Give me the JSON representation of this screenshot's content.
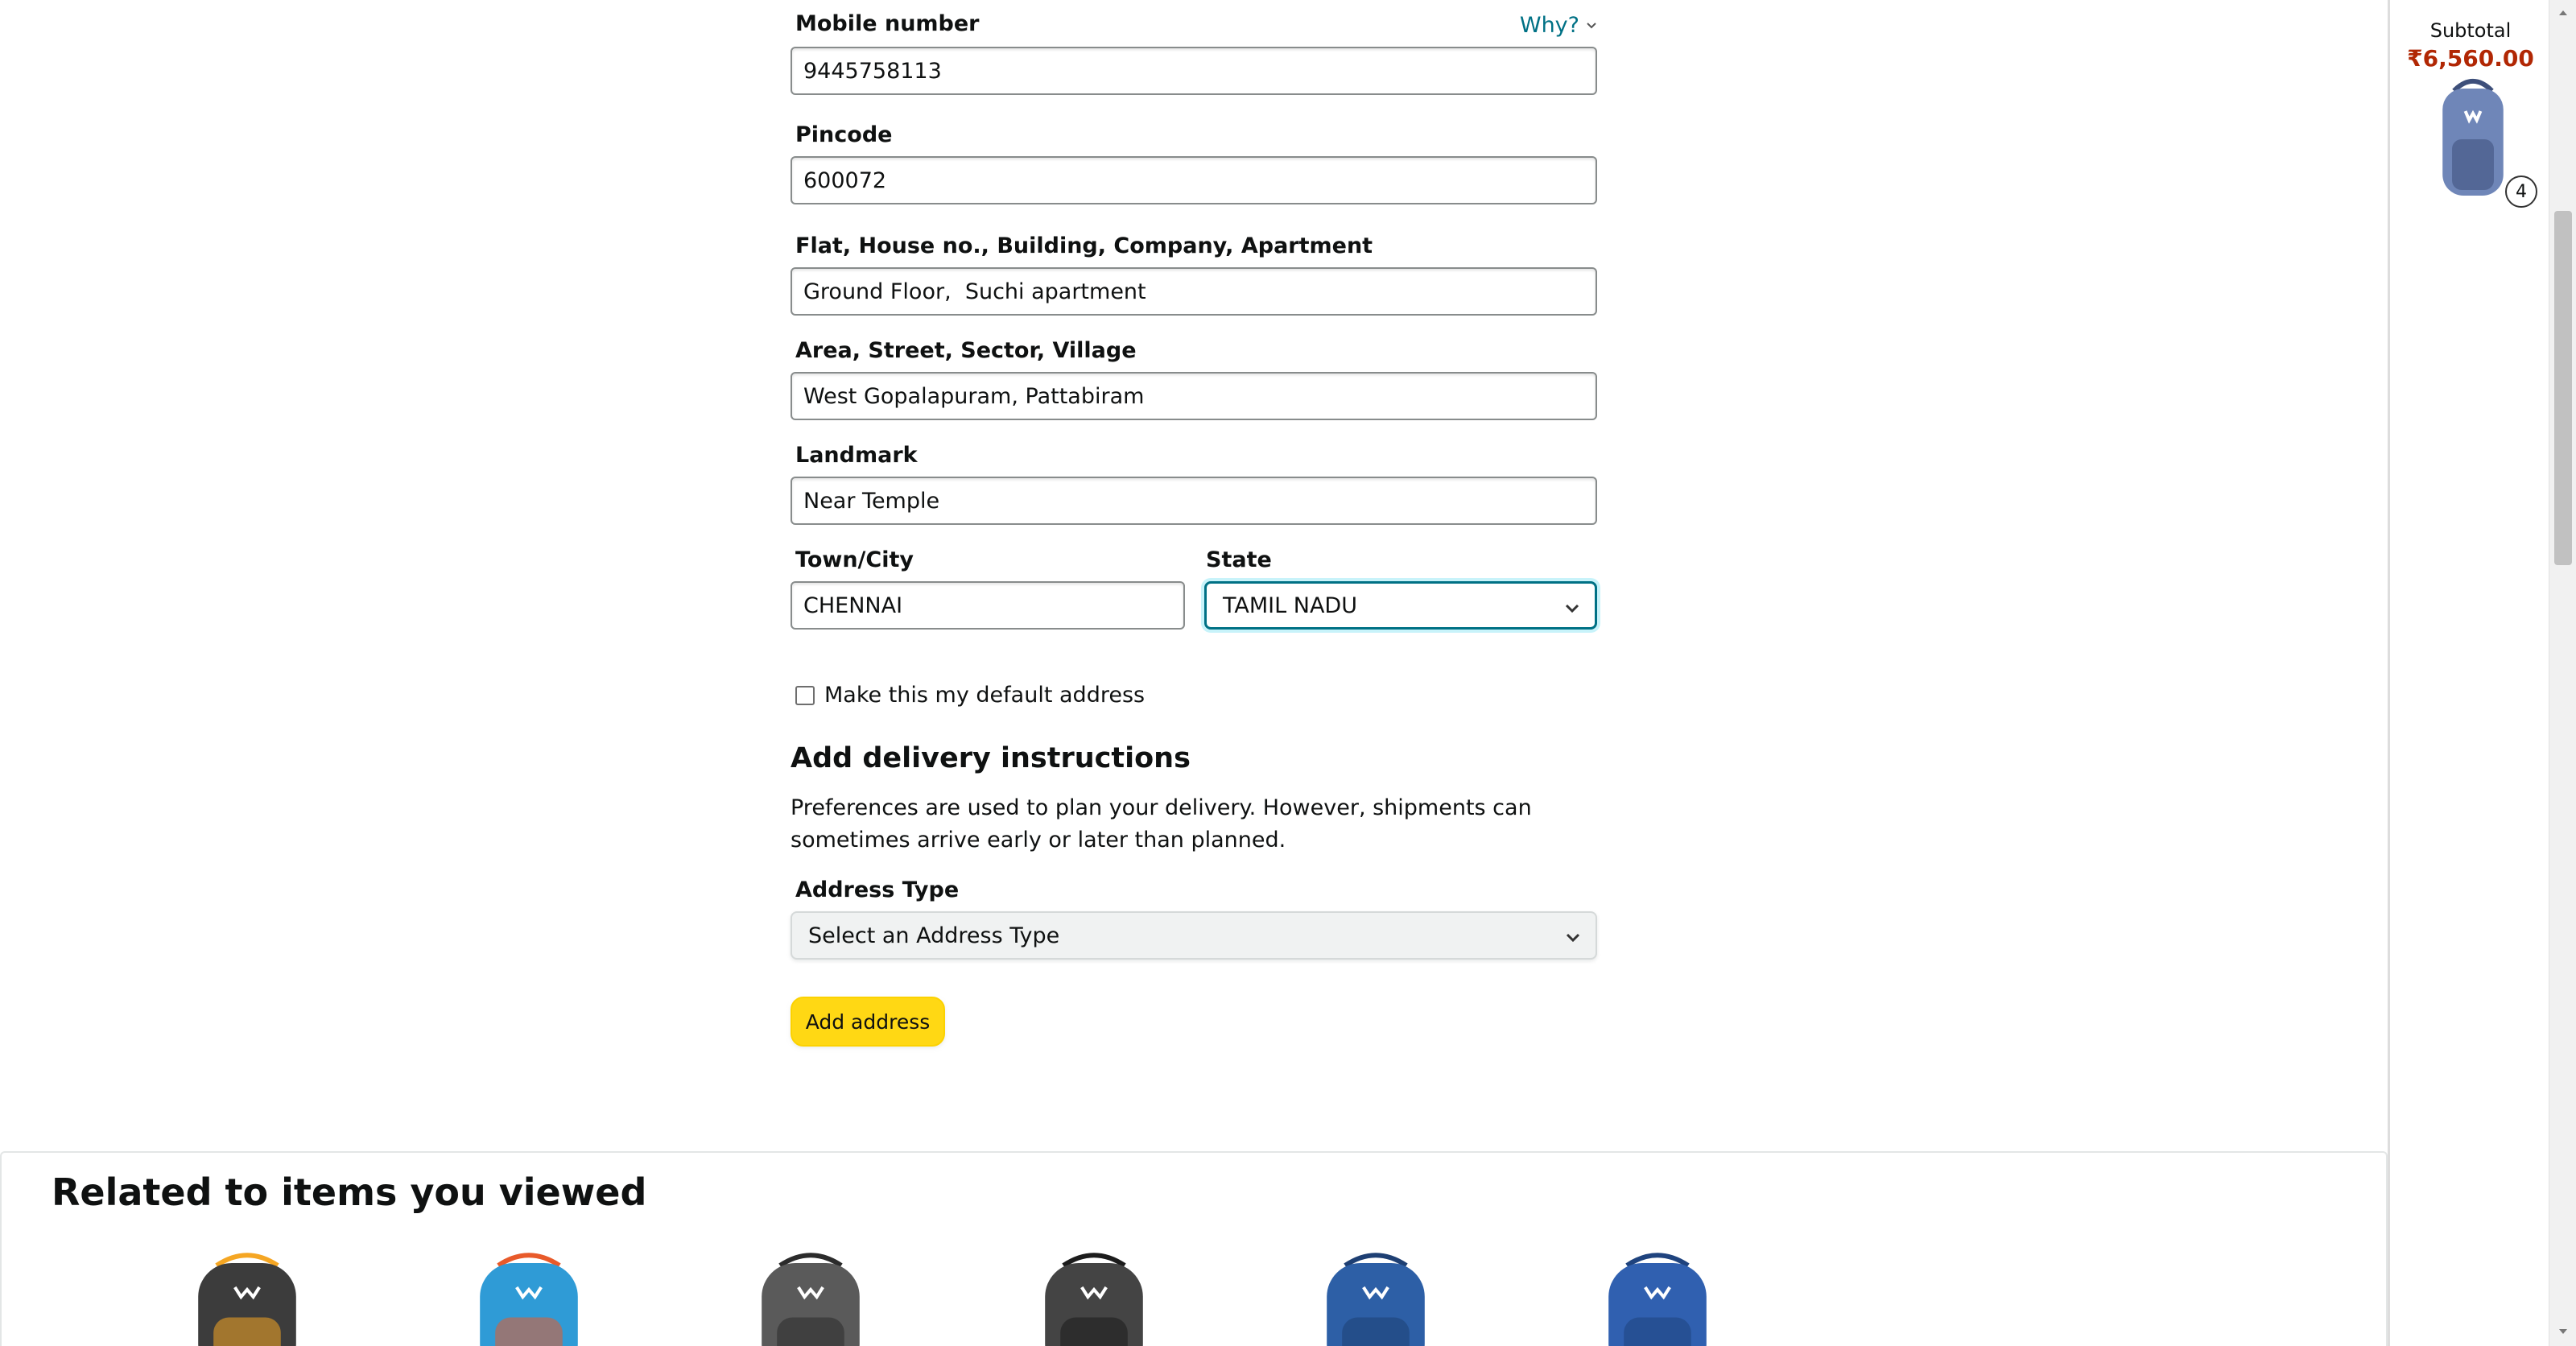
{
  "form": {
    "mobile": {
      "label": "Mobile number",
      "value": "9445758113",
      "why_link": "Why?"
    },
    "pincode": {
      "label": "Pincode",
      "value": "600072"
    },
    "flat": {
      "label": "Flat, House no., Building, Company, Apartment",
      "value": "Ground Floor,  Suchi apartment"
    },
    "area": {
      "label": "Area, Street, Sector, Village",
      "value": "West Gopalapuram, Pattabiram"
    },
    "landmark": {
      "label": "Landmark",
      "value": "Near Temple"
    },
    "city": {
      "label": "Town/City",
      "value": "CHENNAI"
    },
    "state": {
      "label": "State",
      "value": "TAMIL NADU"
    },
    "default_checkbox": {
      "label": "Make this my default address",
      "checked": false
    },
    "instructions": {
      "heading": "Add delivery instructions",
      "description": "Preferences are used to plan your delivery. However, shipments can sometimes arrive early or later than planned."
    },
    "address_type": {
      "label": "Address Type",
      "value": "Select an Address Type"
    },
    "submit_label": "Add address"
  },
  "related": {
    "title": "Related to items you viewed",
    "products": [
      {
        "color": "#3c3c3c",
        "accent": "#f5a623"
      },
      {
        "color": "#2f9bd6",
        "accent": "#e85a2a"
      },
      {
        "color": "#5a5a5a",
        "accent": "#2b2b2b"
      },
      {
        "color": "#444444",
        "accent": "#1c1c1c"
      },
      {
        "color": "#2d5fa6",
        "accent": "#1e3f73"
      },
      {
        "color": "#3060b0",
        "accent": "#1f437e"
      }
    ]
  },
  "cart": {
    "subtotal_label": "Subtotal",
    "subtotal_value": "₹6,560.00",
    "quantity": "4",
    "item_color": "#6f86b8"
  },
  "colors": {
    "link": "#007185",
    "price": "#b12704",
    "button": "#ffd814"
  }
}
